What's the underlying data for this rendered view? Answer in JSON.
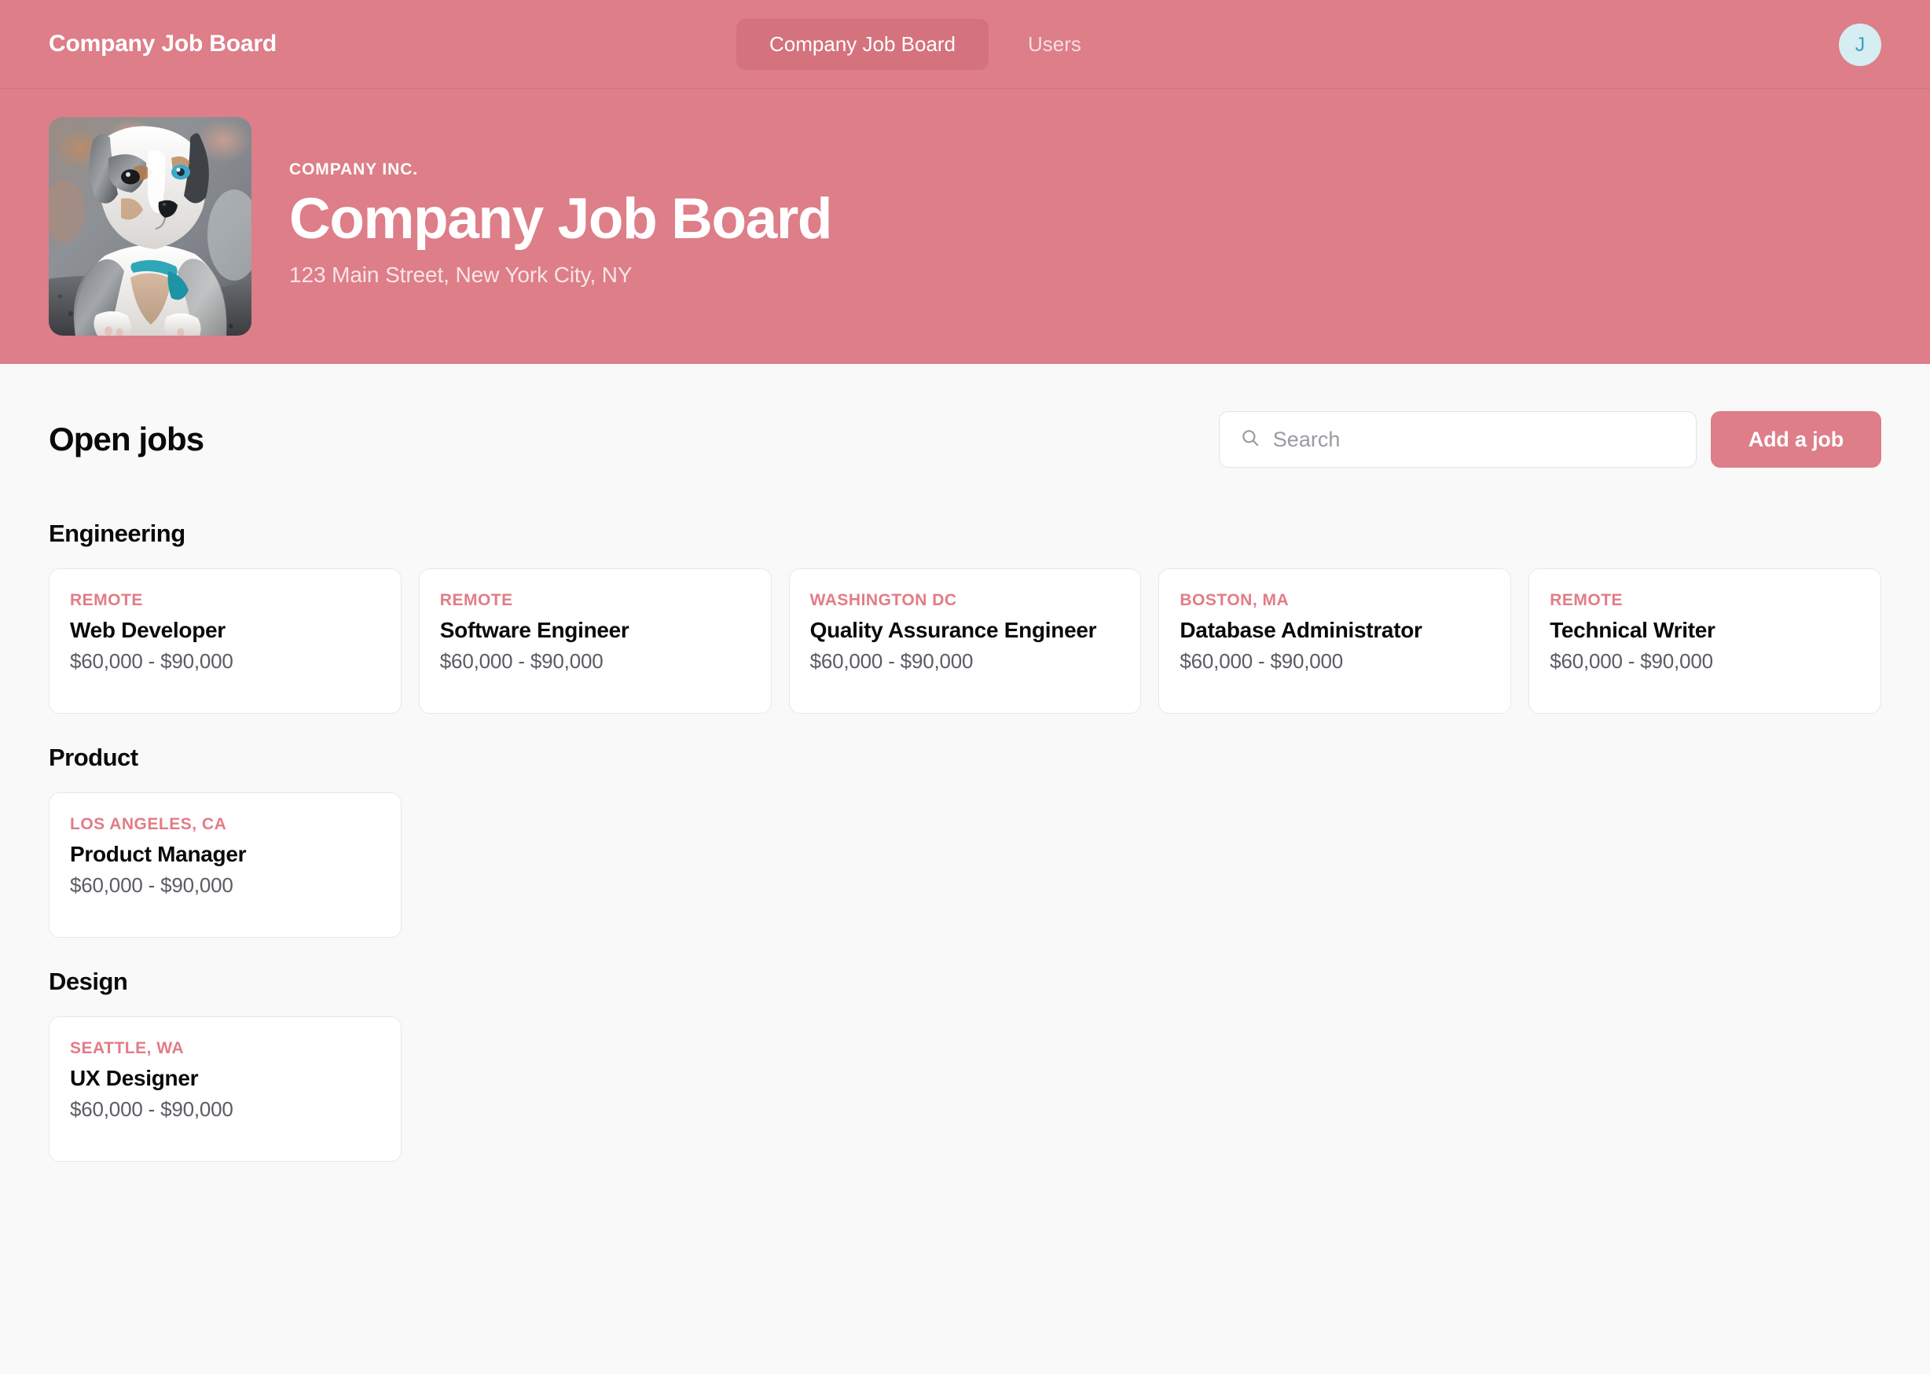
{
  "navbar": {
    "brand": "Company Job Board",
    "links": [
      {
        "label": "Company Job Board",
        "active": true
      },
      {
        "label": "Users",
        "active": false
      }
    ],
    "avatar_initial": "J",
    "background_color": "#DD7E88",
    "active_pill_color": "#D4727D",
    "avatar_bg_color": "#D6EDF2",
    "avatar_text_color": "#3AA3BC"
  },
  "hero": {
    "eyebrow": "COMPANY INC.",
    "title": "Company Job Board",
    "address": "123 Main Street, New York City, NY",
    "photo_alt": "australian-shepherd-puppy-photo",
    "background_color": "#DD7E88"
  },
  "main": {
    "page_title": "Open jobs",
    "search": {
      "placeholder": "Search",
      "value": "",
      "icon": "search-icon"
    },
    "add_job_button": {
      "label": "Add a job",
      "color": "#DD7E88"
    },
    "accent_color": "#E27C86",
    "page_background": "#F9F9FA",
    "sections": [
      {
        "title": "Engineering",
        "jobs": [
          {
            "location": "REMOTE",
            "title": "Web Developer",
            "salary": "$60,000 - $90,000"
          },
          {
            "location": "REMOTE",
            "title": "Software Engineer",
            "salary": "$60,000 - $90,000"
          },
          {
            "location": "WASHINGTON DC",
            "title": "Quality Assurance Engineer",
            "salary": "$60,000 - $90,000"
          },
          {
            "location": "BOSTON, MA",
            "title": "Database Administrator",
            "salary": "$60,000 - $90,000"
          },
          {
            "location": "REMOTE",
            "title": "Technical Writer",
            "salary": "$60,000 - $90,000"
          }
        ]
      },
      {
        "title": "Product",
        "jobs": [
          {
            "location": "LOS ANGELES, CA",
            "title": "Product Manager",
            "salary": "$60,000 - $90,000"
          }
        ]
      },
      {
        "title": "Design",
        "jobs": [
          {
            "location": "SEATTLE, WA",
            "title": "UX Designer",
            "salary": "$60,000 - $90,000"
          }
        ]
      }
    ]
  }
}
